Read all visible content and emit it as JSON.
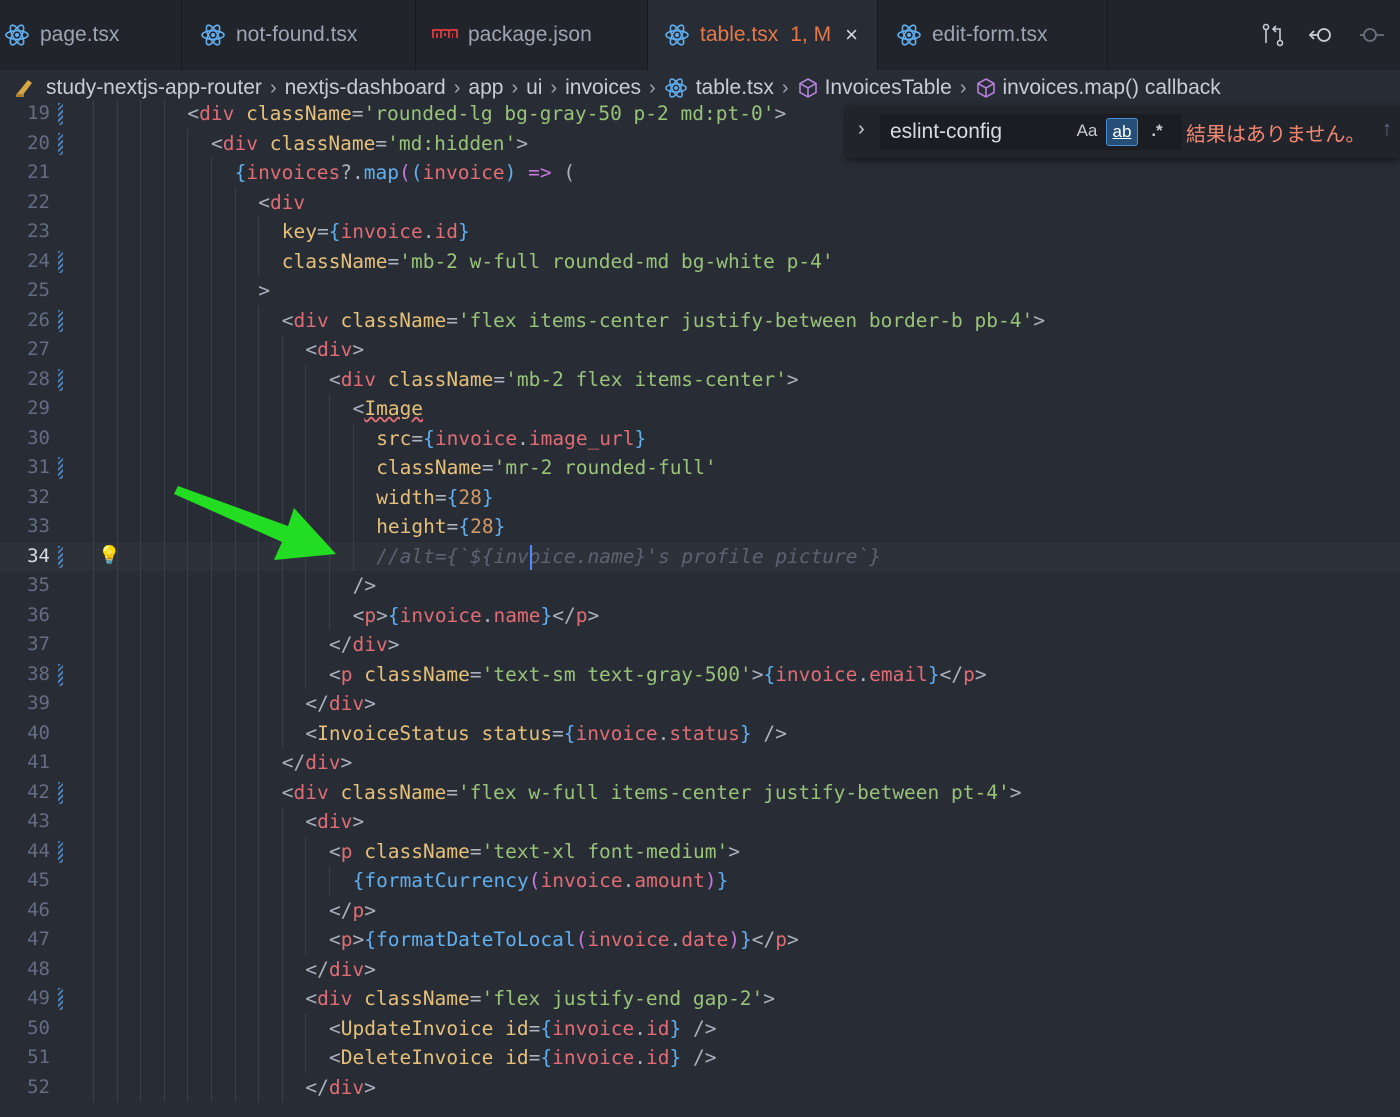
{
  "tabs": [
    {
      "label": "page.tsx",
      "icon": "react-icon",
      "active": false
    },
    {
      "label": "not-found.tsx",
      "icon": "react-icon",
      "active": false
    },
    {
      "label": "package.json",
      "icon": "npm-icon",
      "active": false
    },
    {
      "label": "table.tsx",
      "icon": "react-icon",
      "active": true,
      "status": "1, M",
      "close": "×"
    },
    {
      "label": "edit-form.tsx",
      "icon": "react-icon",
      "active": false
    }
  ],
  "toolbar_icons": [
    "compare-changes-icon",
    "go-back-icon",
    "go-forward-icon"
  ],
  "breadcrumb": [
    {
      "label": "study-nextjs-app-router",
      "icon": "folder-icon"
    },
    {
      "label": "nextjs-dashboard"
    },
    {
      "label": "app"
    },
    {
      "label": "ui"
    },
    {
      "label": "invoices"
    },
    {
      "label": "table.tsx",
      "icon": "react-icon"
    },
    {
      "label": "InvoicesTable",
      "icon": "symbol-method-icon"
    },
    {
      "label": "invoices.map() callback",
      "icon": "symbol-method-icon"
    }
  ],
  "find_widget": {
    "toggle": "›",
    "query": "eslint-config",
    "match_case": "Aa",
    "whole_word": "ab",
    "regex": ".*",
    "result": "結果はありません。",
    "prev": "↑"
  },
  "editor": {
    "current_line": 34,
    "lines": [
      {
        "n": 19,
        "indent": 4,
        "mod": true,
        "tokens": [
          [
            "<",
            "b"
          ],
          [
            "div",
            "tag"
          ],
          [
            " className",
            "attr"
          ],
          [
            "=",
            "b"
          ],
          [
            "'rounded-lg bg-gray-50 p-2 md:pt-0'",
            "str"
          ],
          [
            ">",
            "b"
          ]
        ]
      },
      {
        "n": 20,
        "indent": 5,
        "mod": true,
        "tokens": [
          [
            "<",
            "b"
          ],
          [
            "div",
            "tag"
          ],
          [
            " className",
            "attr"
          ],
          [
            "=",
            "b"
          ],
          [
            "'md:hidden'",
            "str"
          ],
          [
            ">",
            "b"
          ]
        ]
      },
      {
        "n": 21,
        "indent": 6,
        "mod": false,
        "tokens": [
          [
            "{",
            "br"
          ],
          [
            "invoices",
            "v"
          ],
          [
            "?.",
            "b"
          ],
          [
            "map",
            "fn"
          ],
          [
            "(",
            "op"
          ],
          [
            "(",
            "br"
          ],
          [
            "invoice",
            "v"
          ],
          [
            ")",
            "br"
          ],
          [
            " => ",
            "op"
          ],
          [
            "(",
            "b"
          ]
        ]
      },
      {
        "n": 22,
        "indent": 7,
        "mod": false,
        "tokens": [
          [
            "<",
            "b"
          ],
          [
            "div",
            "tag"
          ]
        ]
      },
      {
        "n": 23,
        "indent": 8,
        "mod": false,
        "tokens": [
          [
            "key",
            "attr"
          ],
          [
            "=",
            "b"
          ],
          [
            "{",
            "br"
          ],
          [
            "invoice",
            "v"
          ],
          [
            ".",
            "b"
          ],
          [
            "id",
            "v"
          ],
          [
            "}",
            "br"
          ]
        ]
      },
      {
        "n": 24,
        "indent": 8,
        "mod": true,
        "tokens": [
          [
            "className",
            "attr"
          ],
          [
            "=",
            "b"
          ],
          [
            "'mb-2 w-full rounded-md bg-white p-4'",
            "str"
          ]
        ]
      },
      {
        "n": 25,
        "indent": 7,
        "mod": false,
        "tokens": [
          [
            ">",
            "b"
          ]
        ]
      },
      {
        "n": 26,
        "indent": 8,
        "mod": true,
        "tokens": [
          [
            "<",
            "b"
          ],
          [
            "div",
            "tag"
          ],
          [
            " className",
            "attr"
          ],
          [
            "=",
            "b"
          ],
          [
            "'flex items-center justify-between border-b pb-4'",
            "str"
          ],
          [
            ">",
            "b"
          ]
        ]
      },
      {
        "n": 27,
        "indent": 9,
        "mod": false,
        "tokens": [
          [
            "<",
            "b"
          ],
          [
            "div",
            "tag"
          ],
          [
            ">",
            "b"
          ]
        ]
      },
      {
        "n": 28,
        "indent": 10,
        "mod": true,
        "tokens": [
          [
            "<",
            "b"
          ],
          [
            "div",
            "tag"
          ],
          [
            " className",
            "attr"
          ],
          [
            "=",
            "b"
          ],
          [
            "'mb-2 flex items-center'",
            "str"
          ],
          [
            ">",
            "b"
          ]
        ]
      },
      {
        "n": 29,
        "indent": 11,
        "mod": false,
        "tokens": [
          [
            "<",
            "b"
          ],
          [
            "Image",
            "comp-sq"
          ]
        ]
      },
      {
        "n": 30,
        "indent": 12,
        "mod": false,
        "tokens": [
          [
            "src",
            "attr"
          ],
          [
            "=",
            "b"
          ],
          [
            "{",
            "br"
          ],
          [
            "invoice",
            "v"
          ],
          [
            ".",
            "b"
          ],
          [
            "image_url",
            "v"
          ],
          [
            "}",
            "br"
          ]
        ]
      },
      {
        "n": 31,
        "indent": 12,
        "mod": true,
        "tokens": [
          [
            "className",
            "attr"
          ],
          [
            "=",
            "b"
          ],
          [
            "'mr-2 rounded-full'",
            "str"
          ]
        ]
      },
      {
        "n": 32,
        "indent": 12,
        "mod": false,
        "tokens": [
          [
            "width",
            "attr"
          ],
          [
            "=",
            "b"
          ],
          [
            "{",
            "br"
          ],
          [
            "28",
            "num"
          ],
          [
            "}",
            "br"
          ]
        ]
      },
      {
        "n": 33,
        "indent": 12,
        "mod": false,
        "tokens": [
          [
            "height",
            "attr"
          ],
          [
            "=",
            "b"
          ],
          [
            "{",
            "br"
          ],
          [
            "28",
            "num"
          ],
          [
            "}",
            "br"
          ]
        ]
      },
      {
        "n": 34,
        "indent": 12,
        "mod": true,
        "bulb": true,
        "tokens": [
          [
            "//alt={`${invoice.name}'s profile picture`}",
            "com"
          ]
        ]
      },
      {
        "n": 35,
        "indent": 11,
        "mod": false,
        "tokens": [
          [
            "/>",
            "b"
          ]
        ]
      },
      {
        "n": 36,
        "indent": 11,
        "mod": false,
        "tokens": [
          [
            "<",
            "b"
          ],
          [
            "p",
            "tag"
          ],
          [
            ">",
            "b"
          ],
          [
            "{",
            "br"
          ],
          [
            "invoice",
            "v"
          ],
          [
            ".",
            "b"
          ],
          [
            "name",
            "v"
          ],
          [
            "}",
            "br"
          ],
          [
            "</",
            "b"
          ],
          [
            "p",
            "tag"
          ],
          [
            ">",
            "b"
          ]
        ]
      },
      {
        "n": 37,
        "indent": 10,
        "mod": false,
        "tokens": [
          [
            "</",
            "b"
          ],
          [
            "div",
            "tag"
          ],
          [
            ">",
            "b"
          ]
        ]
      },
      {
        "n": 38,
        "indent": 10,
        "mod": true,
        "tokens": [
          [
            "<",
            "b"
          ],
          [
            "p",
            "tag"
          ],
          [
            " className",
            "attr"
          ],
          [
            "=",
            "b"
          ],
          [
            "'text-sm text-gray-500'",
            "str"
          ],
          [
            ">",
            "b"
          ],
          [
            "{",
            "br"
          ],
          [
            "invoice",
            "v"
          ],
          [
            ".",
            "b"
          ],
          [
            "email",
            "v"
          ],
          [
            "}",
            "br"
          ],
          [
            "</",
            "b"
          ],
          [
            "p",
            "tag"
          ],
          [
            ">",
            "b"
          ]
        ]
      },
      {
        "n": 39,
        "indent": 9,
        "mod": false,
        "tokens": [
          [
            "</",
            "b"
          ],
          [
            "div",
            "tag"
          ],
          [
            ">",
            "b"
          ]
        ]
      },
      {
        "n": 40,
        "indent": 9,
        "mod": false,
        "tokens": [
          [
            "<",
            "b"
          ],
          [
            "InvoiceStatus",
            "comp"
          ],
          [
            " status",
            "attr"
          ],
          [
            "=",
            "b"
          ],
          [
            "{",
            "br"
          ],
          [
            "invoice",
            "v"
          ],
          [
            ".",
            "b"
          ],
          [
            "status",
            "v"
          ],
          [
            "}",
            "br"
          ],
          [
            " />",
            "b"
          ]
        ]
      },
      {
        "n": 41,
        "indent": 8,
        "mod": false,
        "tokens": [
          [
            "</",
            "b"
          ],
          [
            "div",
            "tag"
          ],
          [
            ">",
            "b"
          ]
        ]
      },
      {
        "n": 42,
        "indent": 8,
        "mod": true,
        "tokens": [
          [
            "<",
            "b"
          ],
          [
            "div",
            "tag"
          ],
          [
            " className",
            "attr"
          ],
          [
            "=",
            "b"
          ],
          [
            "'flex w-full items-center justify-between pt-4'",
            "str"
          ],
          [
            ">",
            "b"
          ]
        ]
      },
      {
        "n": 43,
        "indent": 9,
        "mod": false,
        "tokens": [
          [
            "<",
            "b"
          ],
          [
            "div",
            "tag"
          ],
          [
            ">",
            "b"
          ]
        ]
      },
      {
        "n": 44,
        "indent": 10,
        "mod": true,
        "tokens": [
          [
            "<",
            "b"
          ],
          [
            "p",
            "tag"
          ],
          [
            " className",
            "attr"
          ],
          [
            "=",
            "b"
          ],
          [
            "'text-xl font-medium'",
            "str"
          ],
          [
            ">",
            "b"
          ]
        ]
      },
      {
        "n": 45,
        "indent": 11,
        "mod": false,
        "tokens": [
          [
            "{",
            "br"
          ],
          [
            "formatCurrency",
            "fn"
          ],
          [
            "(",
            "op"
          ],
          [
            "invoice",
            "v"
          ],
          [
            ".",
            "b"
          ],
          [
            "amount",
            "v"
          ],
          [
            ")",
            "op"
          ],
          [
            "}",
            "br"
          ]
        ]
      },
      {
        "n": 46,
        "indent": 10,
        "mod": false,
        "tokens": [
          [
            "</",
            "b"
          ],
          [
            "p",
            "tag"
          ],
          [
            ">",
            "b"
          ]
        ]
      },
      {
        "n": 47,
        "indent": 10,
        "mod": false,
        "tokens": [
          [
            "<",
            "b"
          ],
          [
            "p",
            "tag"
          ],
          [
            ">",
            "b"
          ],
          [
            "{",
            "br"
          ],
          [
            "formatDateToLocal",
            "fn"
          ],
          [
            "(",
            "op"
          ],
          [
            "invoice",
            "v"
          ],
          [
            ".",
            "b"
          ],
          [
            "date",
            "v"
          ],
          [
            ")",
            "op"
          ],
          [
            "}",
            "br"
          ],
          [
            "</",
            "b"
          ],
          [
            "p",
            "tag"
          ],
          [
            ">",
            "b"
          ]
        ]
      },
      {
        "n": 48,
        "indent": 9,
        "mod": false,
        "tokens": [
          [
            "</",
            "b"
          ],
          [
            "div",
            "tag"
          ],
          [
            ">",
            "b"
          ]
        ]
      },
      {
        "n": 49,
        "indent": 9,
        "mod": true,
        "tokens": [
          [
            "<",
            "b"
          ],
          [
            "div",
            "tag"
          ],
          [
            " className",
            "attr"
          ],
          [
            "=",
            "b"
          ],
          [
            "'flex justify-end gap-2'",
            "str"
          ],
          [
            ">",
            "b"
          ]
        ]
      },
      {
        "n": 50,
        "indent": 10,
        "mod": false,
        "tokens": [
          [
            "<",
            "b"
          ],
          [
            "UpdateInvoice",
            "comp"
          ],
          [
            " id",
            "attr"
          ],
          [
            "=",
            "b"
          ],
          [
            "{",
            "br"
          ],
          [
            "invoice",
            "v"
          ],
          [
            ".",
            "b"
          ],
          [
            "id",
            "v"
          ],
          [
            "}",
            "br"
          ],
          [
            " />",
            "b"
          ]
        ]
      },
      {
        "n": 51,
        "indent": 10,
        "mod": false,
        "tokens": [
          [
            "<",
            "b"
          ],
          [
            "DeleteInvoice",
            "comp"
          ],
          [
            " id",
            "attr"
          ],
          [
            "=",
            "b"
          ],
          [
            "{",
            "br"
          ],
          [
            "invoice",
            "v"
          ],
          [
            ".",
            "b"
          ],
          [
            "id",
            "v"
          ],
          [
            "}",
            "br"
          ],
          [
            " />",
            "b"
          ]
        ]
      },
      {
        "n": 52,
        "indent": 9,
        "mod": false,
        "tokens": [
          [
            "</",
            "b"
          ],
          [
            "div",
            "tag"
          ],
          [
            ">",
            "b"
          ]
        ]
      }
    ]
  },
  "annotation_arrow_color": "#22dd22"
}
